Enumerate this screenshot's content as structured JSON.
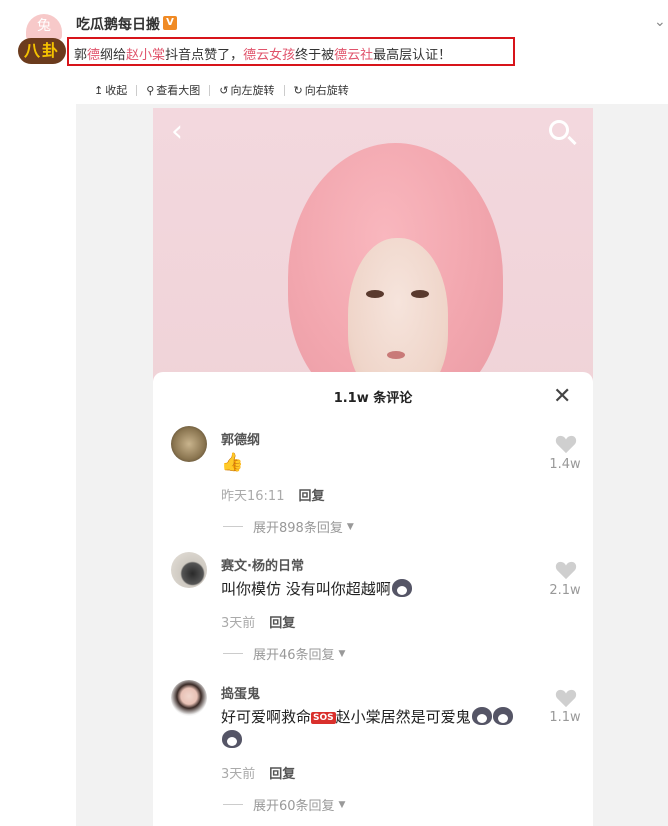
{
  "header": {
    "username": "吃瓜鹅每日搬",
    "verified_badge": "V",
    "avatar_top": "兔",
    "avatar_bottom": "八卦",
    "post": {
      "p1": "郭",
      "p2": "德",
      "p3": "纲给",
      "p4": "赵小棠",
      "p5": "抖音点赞了，",
      "p6": "德云女孩",
      "p7": "终于被",
      "p8": "德云社",
      "p9": "最高层认证！"
    },
    "highlight_color": "#e0536b",
    "box_color": "#d7141a"
  },
  "toolbar": {
    "collapse": "收起",
    "view_large": "查看大图",
    "rotate_left": "向左旋转",
    "rotate_right": "向右旋转"
  },
  "comments_sheet": {
    "title": "1.1w 条评论",
    "comments": [
      {
        "name": "郭德纲",
        "text": "",
        "emoji": "thumbs-up",
        "time": "昨天16:11",
        "reply": "回复",
        "expand": "展开898条回复",
        "likes": "1.4w"
      },
      {
        "name": "赛文·杨的日常",
        "text": "叫你模仿 没有叫你超越啊",
        "emoji": "husky",
        "time": "3天前",
        "reply": "回复",
        "expand": "展开46条回复",
        "likes": "2.1w"
      },
      {
        "name": "捣蛋鬼",
        "text_a": "好可爱啊救命",
        "sos": "SOS",
        "text_b": "赵小棠居然是可爱鬼",
        "emoji": "husky",
        "time": "3天前",
        "reply": "回复",
        "expand": "展开60条回复",
        "likes": "1.1w"
      }
    ]
  }
}
